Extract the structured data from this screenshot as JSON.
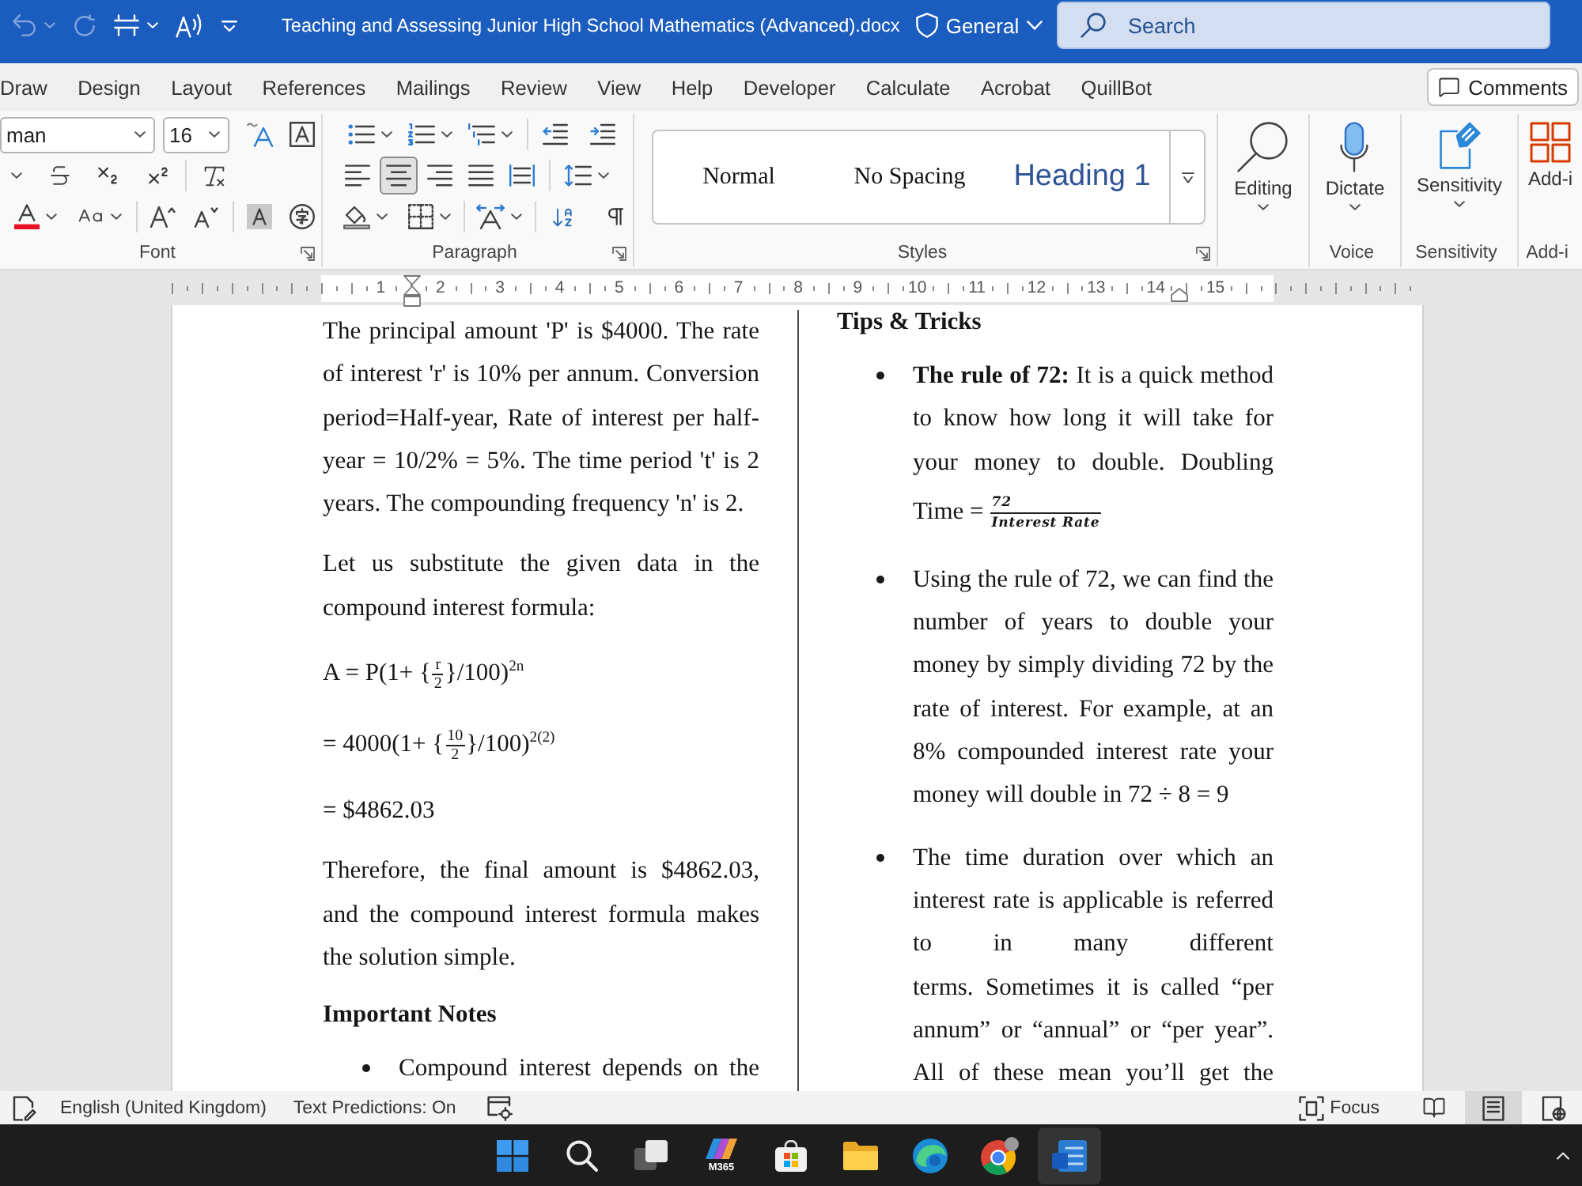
{
  "title_bar": {
    "quick_access": [
      {
        "kind": "undo",
        "disabled": true
      },
      {
        "kind": "redo",
        "disabled": true
      },
      {
        "kind": "touch_mode",
        "disabled": false
      },
      {
        "kind": "read_aloud",
        "disabled": false
      },
      {
        "kind": "customize",
        "disabled": false
      }
    ],
    "title": "Teaching and Assessing Junior High School Mathematics (Advanced).docx",
    "sensitivity_label": "General",
    "search": {
      "placeholder": "Search"
    }
  },
  "tabs": [
    {
      "label": "Draw",
      "selected": false
    },
    {
      "label": "Design",
      "selected": false
    },
    {
      "label": "Layout",
      "selected": false
    },
    {
      "label": "References",
      "selected": false
    },
    {
      "label": "Mailings",
      "selected": false
    },
    {
      "label": "Review",
      "selected": false
    },
    {
      "label": "View",
      "selected": false
    },
    {
      "label": "Help",
      "selected": false
    },
    {
      "label": "Developer",
      "selected": false
    },
    {
      "label": "Calculate",
      "selected": false
    },
    {
      "label": "Acrobat",
      "selected": false
    },
    {
      "label": "QuillBot",
      "selected": false
    }
  ],
  "comments_button": "Comments",
  "ribbon": {
    "font": {
      "font_name": "man",
      "font_size": "16",
      "label": "Font"
    },
    "paragraph": {
      "alignment": [
        {
          "kind": "left",
          "selected": false
        },
        {
          "kind": "center",
          "selected": true
        },
        {
          "kind": "right",
          "selected": false
        },
        {
          "kind": "justify",
          "selected": false
        },
        {
          "kind": "distributed",
          "selected": false
        }
      ],
      "label": "Paragraph"
    },
    "styles": {
      "items": [
        {
          "kind": "body",
          "label": "Normal"
        },
        {
          "kind": "body",
          "label": "No Spacing"
        },
        {
          "kind": "heading",
          "label": "Heading 1"
        }
      ],
      "label": "Styles"
    },
    "command_groups": [
      {
        "kind": "editing",
        "button": "Editing"
      },
      {
        "kind": "voice",
        "button": "Dictate",
        "label": "Voice"
      },
      {
        "kind": "sensitivity",
        "button": "Sensitivity",
        "label": "Sensitivity"
      },
      {
        "kind": "add_ins",
        "button": "Add-i",
        "label": "Add-i"
      }
    ]
  },
  "ruler": {
    "numbers": [
      "1",
      "2",
      "3",
      "4",
      "5",
      "6",
      "7",
      "8",
      "9",
      "10",
      "11",
      "12",
      "13",
      "14",
      "15"
    ]
  },
  "document": {
    "left_column": [
      {
        "kind": "paragraph",
        "lines": [
          "The principal amount 'P' is $4000. The rate",
          "of interest 'r' is 10% per annum. Conversion",
          "period=Half-year, Rate of interest per half-",
          "year = 10/2% = 5%. The time period 't' is 2",
          "years. The compounding frequency 'n' is 2."
        ]
      },
      {
        "kind": "paragraph",
        "lines": [
          "Let us substitute the given data in the",
          "compound interest formula:"
        ]
      },
      {
        "kind": "formula",
        "before": "A = P(1+ {",
        "numerator": "r",
        "denominator": "2",
        "after": "}/100)$^{2n}$"
      },
      {
        "kind": "formula",
        "before": "= 4000(1+ {",
        "numerator": "10",
        "denominator": "2",
        "after": "}/100)$^{2(2)}$"
      },
      {
        "kind": "paragraph",
        "lines": [
          "= $4862.03"
        ]
      },
      {
        "kind": "paragraph",
        "lines": [
          "Therefore, the final amount is $4862.03,",
          "and the compound interest formula makes",
          "the solution simple."
        ]
      },
      {
        "kind": "heading",
        "text": "Important Notes"
      },
      {
        "kind": "bullet",
        "lines": [
          "Compound interest depends on the"
        ],
        "continues_below": true
      }
    ],
    "right_column": [
      {
        "kind": "heading",
        "text": "Tips & Tricks"
      },
      {
        "kind": "bullet",
        "lines": [
          "**The rule of 72:** It is a quick method",
          "to know how long it will take for",
          "your money to double. Doubling",
          "Time ="
        ],
        "fraction": {
          "numerator": "72",
          "denominator": "Interest Rate"
        }
      },
      {
        "kind": "bullet",
        "lines": [
          "Using the rule of 72, we can find the",
          "number of years to double your",
          "money by simply dividing 72 by the",
          "rate of interest. For example, at an",
          "8% compounded interest rate your",
          "money will double in 72 ÷ 8 = 9"
        ]
      },
      {
        "kind": "bullet",
        "lines": [
          "The time duration over which an",
          "interest rate is applicable is referred",
          "to in many different",
          "terms. Sometimes it is called “per",
          "annum” or “annual” or “per year”.",
          "All of these mean you’ll get the"
        ],
        "continues_below": true
      }
    ]
  },
  "status_bar": {
    "language": "English (United Kingdom)",
    "text_predictions": "Text Predictions: On",
    "focus": "Focus",
    "views": [
      {
        "kind": "read_mode",
        "selected": false
      },
      {
        "kind": "print_layout",
        "selected": true
      },
      {
        "kind": "web_layout",
        "selected": false
      }
    ]
  },
  "taskbar": {
    "items": [
      {
        "kind": "start",
        "selected": false
      },
      {
        "kind": "search",
        "selected": false
      },
      {
        "kind": "task_view",
        "selected": false
      },
      {
        "kind": "m365",
        "selected": false,
        "label": "M365"
      },
      {
        "kind": "store",
        "selected": false
      },
      {
        "kind": "explorer",
        "selected": false
      },
      {
        "kind": "edge",
        "selected": false
      },
      {
        "kind": "chrome",
        "selected": false
      },
      {
        "kind": "word",
        "selected": true
      }
    ]
  }
}
